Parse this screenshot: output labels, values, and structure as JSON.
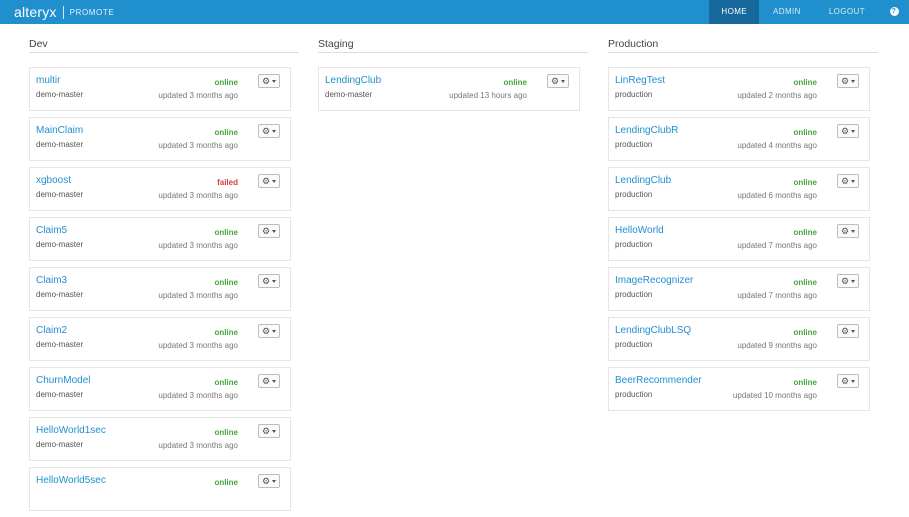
{
  "app": {
    "brand": "alteryx",
    "product": "PROMOTE"
  },
  "nav": {
    "home": "HOME",
    "admin": "ADMIN",
    "logout": "LOGOUT",
    "help": "?"
  },
  "columns": [
    {
      "title": "Dev",
      "cards": [
        {
          "name": "multir",
          "sub": "demo-master",
          "status": "online",
          "updated": "updated 3 months ago"
        },
        {
          "name": "MainClaim",
          "sub": "demo-master",
          "status": "online",
          "updated": "updated 3 months ago"
        },
        {
          "name": "xgboost",
          "sub": "demo-master",
          "status": "failed",
          "updated": "updated 3 months ago"
        },
        {
          "name": "Claim5",
          "sub": "demo-master",
          "status": "online",
          "updated": "updated 3 months ago"
        },
        {
          "name": "Claim3",
          "sub": "demo-master",
          "status": "online",
          "updated": "updated 3 months ago"
        },
        {
          "name": "Claim2",
          "sub": "demo-master",
          "status": "online",
          "updated": "updated 3 months ago"
        },
        {
          "name": "ChurnModel",
          "sub": "demo-master",
          "status": "online",
          "updated": "updated 3 months ago"
        },
        {
          "name": "HelloWorld1sec",
          "sub": "demo-master",
          "status": "online",
          "updated": "updated 3 months ago"
        },
        {
          "name": "HelloWorld5sec",
          "sub": "",
          "status": "online",
          "updated": ""
        }
      ]
    },
    {
      "title": "Staging",
      "cards": [
        {
          "name": "LendingClub",
          "sub": "demo-master",
          "status": "online",
          "updated": "updated 13 hours ago"
        }
      ]
    },
    {
      "title": "Production",
      "cards": [
        {
          "name": "LinRegTest",
          "sub": "production",
          "status": "online",
          "updated": "updated 2 months ago"
        },
        {
          "name": "LendingClubR",
          "sub": "production",
          "status": "online",
          "updated": "updated 4 months ago"
        },
        {
          "name": "LendingClub",
          "sub": "production",
          "status": "online",
          "updated": "updated 6 months ago"
        },
        {
          "name": "HelloWorld",
          "sub": "production",
          "status": "online",
          "updated": "updated 7 months ago"
        },
        {
          "name": "ImageRecognizer",
          "sub": "production",
          "status": "online",
          "updated": "updated 7 months ago"
        },
        {
          "name": "LendingClubLSQ",
          "sub": "production",
          "status": "online",
          "updated": "updated 9 months ago"
        },
        {
          "name": "BeerRecommender",
          "sub": "production",
          "status": "online",
          "updated": "updated 10 months ago"
        }
      ]
    }
  ],
  "icons": {
    "card_menu": "gear-icon",
    "dropdown": "caret-down-icon"
  },
  "colors": {
    "topbar": "#1f8fce",
    "link": "#2190cf",
    "online": "#43a53a",
    "failed": "#d43f3a"
  }
}
